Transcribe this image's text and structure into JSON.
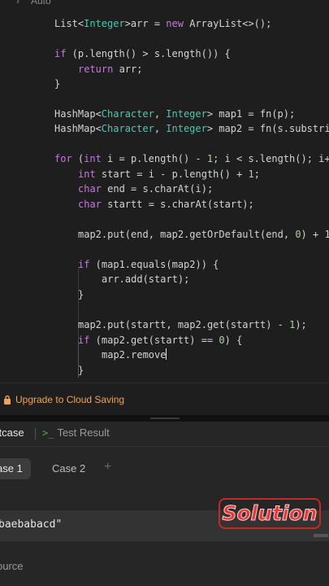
{
  "topbar": {
    "chevron": "›",
    "auto_label": "Auto"
  },
  "code": {
    "l1a": "List<",
    "l1b": "Integer",
    "l1c": ">arr = ",
    "l1d": "new",
    "l1e": " ArrayList<>();",
    "l2a": "if",
    "l2b": " (p.length() > s.length()) {",
    "l3a": "return",
    "l3b": " arr;",
    "l4": "}",
    "l5a": "HashMap<",
    "l5b": "Character",
    "l5c": ", ",
    "l5d": "Integer",
    "l5e": "> map1 = fn(p);",
    "l6a": "HashMap<",
    "l6b": "Character",
    "l6c": ", ",
    "l6d": "Integer",
    "l6e": "> map2 = fn(s.substri",
    "l7a": "for",
    "l7b": " (",
    "l7c": "int",
    "l7d": " i = p.length() - ",
    "l7e": "1",
    "l7f": "; i < s.length(); i+",
    "l8a": "int",
    "l8b": " start = i - p.length() + ",
    "l8c": "1",
    "l8d": ";",
    "l9a": "char",
    "l9b": " end = s.charAt(i);",
    "l10a": "char",
    "l10b": " startt = s.charAt(start);",
    "l11a": "map2.put(end, map2.getOrDefault(end, ",
    "l11b": "0",
    "l11c": ") + 1",
    "l12a": "if",
    "l12b": " (map1.equals(map2)) {",
    "l13": "arr.add(start);",
    "l14": "}",
    "l15a": "map2.put(startt, map2.get(startt) - ",
    "l15b": "1",
    "l15c": ");",
    "l16a": "if",
    "l16b": " (map2.get(startt) == ",
    "l16c": "0",
    "l16d": ") {",
    "l17": "map2.remove",
    "l18": "}"
  },
  "upgrade": {
    "icon": "lock-icon",
    "label": "Upgrade to Cloud Saving"
  },
  "tabs": {
    "testcase": "stcase",
    "result_prompt": ">_",
    "result": "Test Result"
  },
  "cases": {
    "case1": "ase 1",
    "case2": "Case 2",
    "add": "+"
  },
  "input": {
    "value": "baebabacd\""
  },
  "source_label": "ource",
  "badge": {
    "text": "Solution"
  },
  "colors": {
    "accent_orange": "#f0a35a",
    "keyword": "#c678dd",
    "type": "#4ec9b0",
    "badge_red": "#e53935"
  }
}
